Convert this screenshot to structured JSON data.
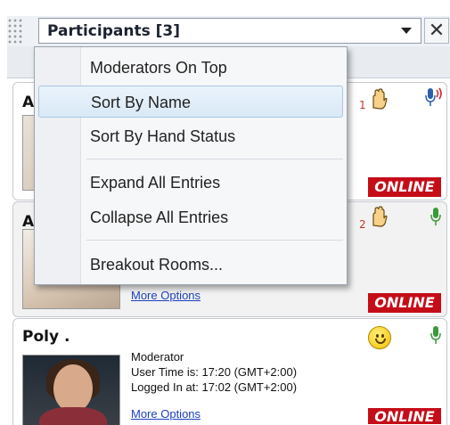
{
  "panel": {
    "title": "Participants [3]"
  },
  "menu": {
    "items": [
      {
        "label": "Moderators On Top"
      },
      {
        "label": "Sort By Name"
      },
      {
        "label": "Sort By Hand Status"
      },
      {
        "label": "Expand All Entries"
      },
      {
        "label": "Collapse All Entries"
      },
      {
        "label": "Breakout Rooms..."
      }
    ],
    "highlighted_index": 1
  },
  "participants": [
    {
      "name": "A",
      "hand_number": "1",
      "status": "ONLINE"
    },
    {
      "name": "A",
      "hand_number": "2",
      "status": "ONLINE",
      "more_options": "More Options"
    },
    {
      "name": "Poly .",
      "role": "Moderator",
      "user_time": "User Time is: 17:20 (GMT+2:00)",
      "logged_in": "Logged In at: 17:02 (GMT+2:00)",
      "more_options": "More Options",
      "status": "ONLINE"
    }
  ],
  "colors": {
    "status_online": "#c50d18",
    "menu_highlight": "#d9e9f7",
    "link": "#1e3fbf"
  }
}
